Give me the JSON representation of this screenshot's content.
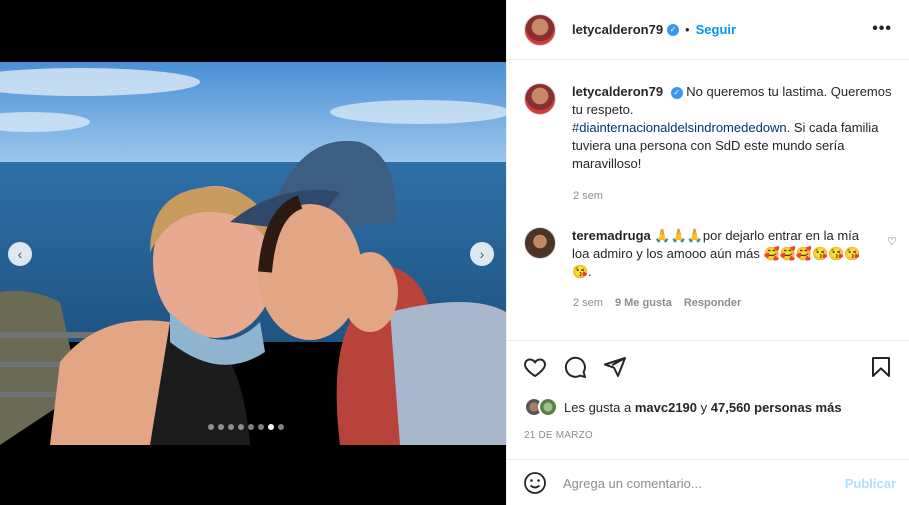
{
  "header": {
    "username": "letycalderon79",
    "separator": "•",
    "follow_label": "Seguir",
    "more_label": "•••"
  },
  "carousel": {
    "prev_label": "‹",
    "next_label": "›",
    "slide_count": 8,
    "active_index": 6
  },
  "caption": {
    "username": "letycalderon79",
    "text_1": "No queremos tu lastima. Queremos tu respeto.",
    "hashtag": "#diainternacionaldelsindromededown",
    "text_2": ". Si cada familia tuviera una persona con SdD este mundo sería maravilloso!",
    "time": "2 sem"
  },
  "comment": {
    "username": "teremadruga",
    "text": "🙏🙏🙏por dejarlo entrar en la mía loa admiro y los amooo aún más 🥰🥰🥰😘😘😘😘.",
    "time": "2 sem",
    "likes": "9 Me gusta",
    "reply_label": "Responder"
  },
  "likes": {
    "prefix": "Les gusta a",
    "user": "mavc2190",
    "connector": "y",
    "count": "47,560 personas más"
  },
  "date": "21 DE MARZO",
  "comment_box": {
    "placeholder": "Agrega un comentario...",
    "post_label": "Publicar"
  },
  "icons": {
    "like": "heart-icon",
    "comment": "comment-icon",
    "share": "share-icon",
    "save": "bookmark-icon",
    "emoji": "emoji-icon",
    "verified": "verified-icon",
    "comment_like": "heart-icon"
  },
  "colors": {
    "accent": "#0095f6",
    "verified": "#3897f0",
    "hashtag": "#00376b",
    "muted": "#8e8e8e",
    "post_disabled": "#b2dffc"
  }
}
